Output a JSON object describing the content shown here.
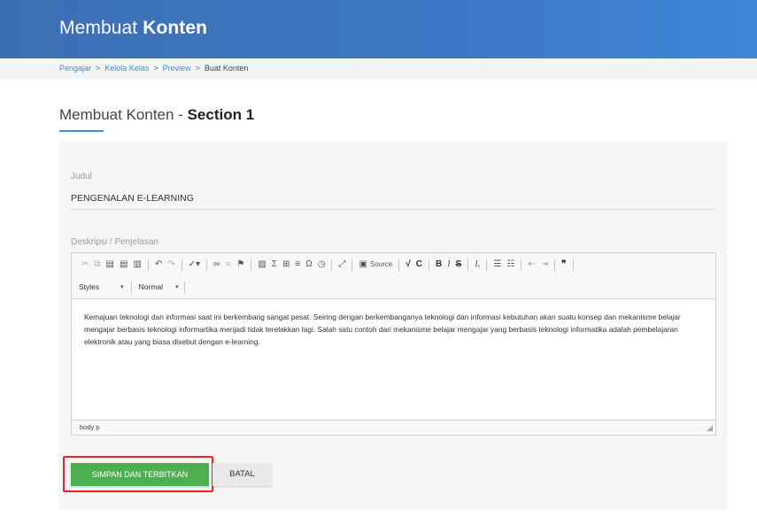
{
  "header": {
    "title_light": "Membuat",
    "title_bold": "Konten",
    "bg_color": "#3b79c6"
  },
  "breadcrumb": {
    "items": [
      "Pengajar",
      "Kelola Kelas",
      "Preview"
    ],
    "current": "Buat Konten",
    "separator": ">"
  },
  "page": {
    "heading_prefix": "Membuat Konten -",
    "heading_section": "Section 1",
    "accent_color": "#3b8fd9"
  },
  "form": {
    "title_label": "Judul",
    "title_value": "PENGENALAN E-LEARNING",
    "description_label": "Deskripsi / Penjelasan"
  },
  "editor": {
    "toolbar_icons": [
      "cut-icon",
      "copy-icon",
      "paste-icon",
      "paste-text-icon",
      "paste-word-icon",
      "undo-icon",
      "redo-icon",
      "spellcheck-icon",
      "link-icon",
      "unlink-icon",
      "anchor-icon",
      "image-icon",
      "math-icon",
      "table-icon",
      "horizontal-rule-icon",
      "special-char-icon",
      "embed-icon",
      "maximize-icon",
      "source-icon",
      "formula-icon",
      "clear-icon",
      "bold-icon",
      "italic-icon",
      "strike-icon",
      "remove-format-icon",
      "numbered-list-icon",
      "bulleted-list-icon",
      "outdent-icon",
      "indent-icon",
      "blockquote-icon"
    ],
    "source_label": "Source",
    "styles_label": "Styles",
    "format_label": "Normal",
    "content": "Kemajuan teknologi dan informasi saat ini berkembang sangat pesat. Seiring dengan berkembanganya teknologi dan informasi kebutuhan akan suatu konsep dan mekanisme belajar mengajar berbasis teknologi informartika menjadi tidak terelakkan lagi. Salah satu contoh dari mekanisme belajar mengajar yang berbasis teknologi informatika adalah pembelajaran elektronik atau yang biasa disebut dengan e-learning.",
    "status_path": "body  p"
  },
  "actions": {
    "save_label": "SIMPAN DAN TERBITKAN",
    "cancel_label": "BATAL",
    "save_color": "#4caf50",
    "highlight_color": "#e3262a"
  }
}
